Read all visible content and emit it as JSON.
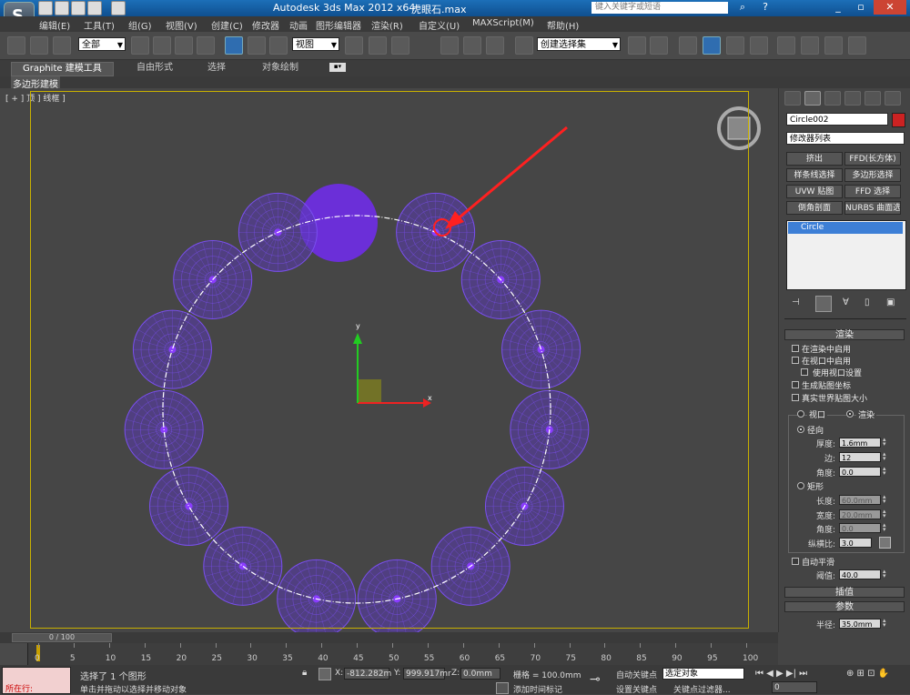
{
  "app": {
    "title": "Autodesk 3ds Max  2012 x64",
    "file": "虎眼石.max",
    "search_placeholder": "键入关键字或短语"
  },
  "menu": [
    "编辑(E)",
    "工具(T)",
    "组(G)",
    "视图(V)",
    "创建(C)",
    "修改器",
    "动画",
    "图形编辑器",
    "渲染(R)",
    "自定义(U)",
    "MAXScript(M)",
    "帮助(H)"
  ],
  "toolbar": {
    "selection_filter": "全部",
    "ref_coord": "视图",
    "snap_label": "3",
    "named_selection": "创建选择集"
  },
  "ribbon": {
    "tabs": [
      "Graphite 建模工具",
      "自由形式",
      "选择",
      "对象绘制"
    ],
    "sub_label": "多边形建模"
  },
  "viewport": {
    "label": "[ + ] 顶 ] 线框 ]",
    "axis_x": "x",
    "axis_y": "y",
    "sphere_color": "#7a4ff0",
    "selected_sphere_color": "#6b2fd8",
    "spline_color": "#ffffff"
  },
  "panel": {
    "object_name": "Circle002",
    "object_color": "#cc2222",
    "modifier_list": "修改器列表",
    "buttons": [
      "挤出",
      "FFD(长方体)",
      "样条线选择",
      "多边形选择",
      "UVW 贴图",
      "FFD 选择",
      "倒角剖面",
      "NURBS 曲面选择"
    ],
    "stack_item": "Circle",
    "render_rollout": "渲染",
    "enable_render": "在渲染中启用",
    "enable_viewport": "在视口中启用",
    "use_viewport_settings": "使用视口设置",
    "gen_mapping": "生成贴图坐标",
    "real_world": "真实世界贴图大小",
    "radio_viewport": "视口",
    "radio_render": "渲染",
    "radial": "径向",
    "thickness_label": "厚度:",
    "thickness": "1.6mm",
    "sides_label": "边:",
    "sides": "12",
    "angle_label": "角度:",
    "angle": "0.0",
    "rectangular": "矩形",
    "length_label": "长度:",
    "length": "60.0mm",
    "width_label": "宽度:",
    "width": "20.0mm",
    "angle2_label": "角度:",
    "angle2": "0.0",
    "aspect_label": "纵横比:",
    "aspect": "3.0",
    "auto_smooth": "自动平滑",
    "threshold_label": "阈值:",
    "threshold": "40.0",
    "interp_rollout": "插值",
    "params_rollout": "参数",
    "radius_label": "半径:",
    "radius": "35.0mm"
  },
  "timeline": {
    "frame": "0 / 100",
    "ticks": [
      "0",
      "5",
      "10",
      "15",
      "20",
      "25",
      "30",
      "35",
      "40",
      "45",
      "50",
      "55",
      "60",
      "65",
      "70",
      "75",
      "80",
      "85",
      "90",
      "95",
      "100"
    ]
  },
  "status": {
    "script_label": "所在行:",
    "msg1": "选择了 1 个图形",
    "msg2": "单击并拖动以选择并移动对象",
    "x": "-812.282m",
    "y": "999.917mr",
    "z": "0.0mm",
    "grid": "栅格 = 100.0mm",
    "add_time_tag": "添加时间标记",
    "auto_key": "自动关键点",
    "selected_obj": "选定对象",
    "set_key": "设置关键点",
    "key_filters": "关键点过滤器...",
    "frame_num": "0"
  },
  "annotation": {
    "color": "#ff2020"
  }
}
